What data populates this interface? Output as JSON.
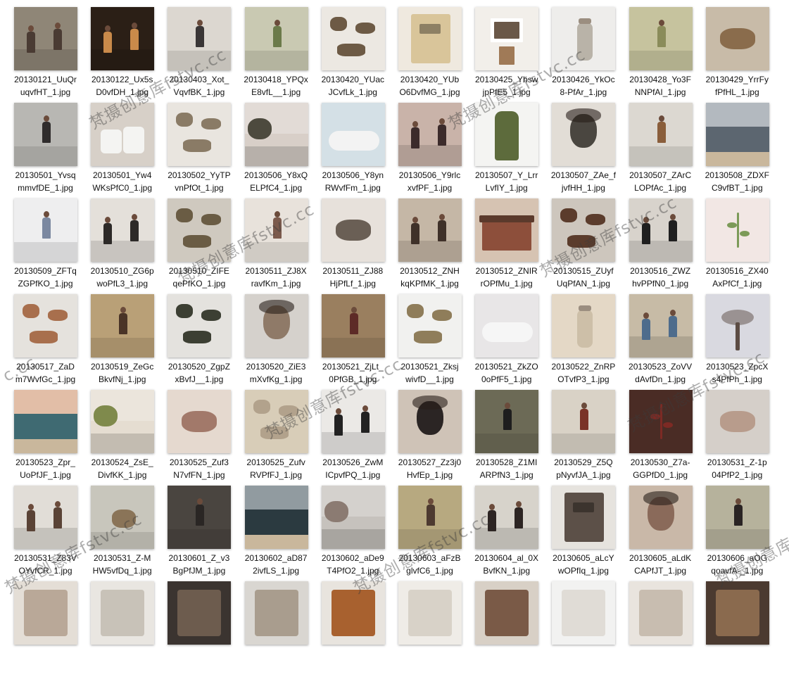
{
  "files": [
    {
      "l1": "20130121_UuQr",
      "l2": "uqvfHT_1.jpg",
      "bg": "#8f8677",
      "fg": "#4a3b33",
      "kind": "people"
    },
    {
      "l1": "20130122_Ux5s",
      "l2": "D0vfDH_1.jpg",
      "bg": "#2b1f16",
      "fg": "#c98a4a",
      "kind": "people"
    },
    {
      "l1": "20130403_Xot_",
      "l2": "VqvfBK_1.jpg",
      "bg": "#dcd7d0",
      "fg": "#3a3636",
      "kind": "person"
    },
    {
      "l1": "20130418_YPQx",
      "l2": "E8vfL__1.jpg",
      "bg": "#c9c9b2",
      "fg": "#6b7a4a",
      "kind": "person"
    },
    {
      "l1": "20130420_YUac",
      "l2": "JCvfLk_1.jpg",
      "bg": "#ece8e2",
      "fg": "#6d5a45",
      "kind": "objects"
    },
    {
      "l1": "20130420_YUb",
      "l2": "O6DvfMG_1.jpg",
      "bg": "#efe9df",
      "fg": "#d9c59a",
      "kind": "book"
    },
    {
      "l1": "20130425_Yhsw",
      "l2": "jpPfE5_1.jpg",
      "bg": "#f2efea",
      "fg": "#6a5848",
      "kind": "frame"
    },
    {
      "l1": "20130426_YkOc",
      "l2": "8-PfAr_1.jpg",
      "bg": "#eeedeb",
      "fg": "#b9b3a8",
      "kind": "jar"
    },
    {
      "l1": "20130428_Yo3F",
      "l2": "NNPfAI_1.jpg",
      "bg": "#c6c39e",
      "fg": "#8a8c5a",
      "kind": "person"
    },
    {
      "l1": "20130429_YrrFy",
      "l2": "fPfHL_1.jpg",
      "bg": "#c8bba8",
      "fg": "#8a6c4c",
      "kind": "hands"
    },
    {
      "l1": "20130501_Yvsq",
      "l2": "mmvfDE_1.jpg",
      "bg": "#b8b7b3",
      "fg": "#2f2c2c",
      "kind": "person"
    },
    {
      "l1": "20130501_Yw4",
      "l2": "WKsPfC0_1.jpg",
      "bg": "#d7d0c8",
      "fg": "#f4f4f2",
      "kind": "shoes"
    },
    {
      "l1": "20130502_YyTP",
      "l2": "vnPfOt_1.jpg",
      "bg": "#e9e5df",
      "fg": "#8a7b66",
      "kind": "objects"
    },
    {
      "l1": "20130506_Y8xQ",
      "l2": "ELPfC4_1.jpg",
      "bg": "#d8cfc8",
      "fg": "#4d4a3e",
      "kind": "road"
    },
    {
      "l1": "20130506_Y8yn",
      "l2": "RWvfFm_1.jpg",
      "bg": "#d4e0e6",
      "fg": "#f3f3f3",
      "kind": "tub"
    },
    {
      "l1": "20130506_Y9rlc",
      "l2": "xvfPF_1.jpg",
      "bg": "#c9b3a9",
      "fg": "#3c2b2b",
      "kind": "people"
    },
    {
      "l1": "20130507_Y_Lrr",
      "l2": "LvfIY_1.jpg",
      "bg": "#f4f4f2",
      "fg": "#5d6b3c",
      "kind": "dress"
    },
    {
      "l1": "20130507_ZAe_f",
      "l2": "jvfHH_1.jpg",
      "bg": "#e2ddd6",
      "fg": "#4a4640",
      "kind": "face"
    },
    {
      "l1": "20130507_ZArC",
      "l2": "LOPfAc_1.jpg",
      "bg": "#dcd8d1",
      "fg": "#8a5e3b",
      "kind": "person"
    },
    {
      "l1": "20130508_ZDXF",
      "l2": "C9vfBT_1.jpg",
      "bg": "#9aa2aa",
      "fg": "#5c6670",
      "kind": "sea"
    },
    {
      "l1": "20130509_ZFTq",
      "l2": "ZGPfKO_1.jpg",
      "bg": "#eeeeef",
      "fg": "#7b88a0",
      "kind": "person"
    },
    {
      "l1": "20130510_ZG6p",
      "l2": "woPfL3_1.jpg",
      "bg": "#e4e0da",
      "fg": "#2d2a28",
      "kind": "people"
    },
    {
      "l1": "20130510_ZIFE",
      "l2": "qePfKO_1.jpg",
      "bg": "#cfc9bf",
      "fg": "#6a5c44",
      "kind": "objects"
    },
    {
      "l1": "20130511_ZJ8X",
      "l2": "ravfKm_1.jpg",
      "bg": "#e8e2db",
      "fg": "#7b5a4c",
      "kind": "person"
    },
    {
      "l1": "20130511_ZJ88",
      "l2": "HjPfLf_1.jpg",
      "bg": "#e7e1db",
      "fg": "#6a5f55",
      "kind": "hands"
    },
    {
      "l1": "20130512_ZNH",
      "l2": "kqKPfMK_1.jpg",
      "bg": "#c5b7a6",
      "fg": "#3f3129",
      "kind": "people"
    },
    {
      "l1": "20130512_ZNIR",
      "l2": "rOPfMu_1.jpg",
      "bg": "#d6c3b2",
      "fg": "#8d4f3b",
      "kind": "house"
    },
    {
      "l1": "20130515_ZUyf",
      "l2": "UqPfAN_1.jpg",
      "bg": "#cdc6bd",
      "fg": "#5b3c2c",
      "kind": "objects"
    },
    {
      "l1": "20130516_ZWZ",
      "l2": "hvPPfN0_1.jpg",
      "bg": "#d8d3cc",
      "fg": "#1f1f1f",
      "kind": "people"
    },
    {
      "l1": "20130516_ZX40",
      "l2": "AxPfCf_1.jpg",
      "bg": "#f2e7e4",
      "fg": "#7c9a58",
      "kind": "flower"
    },
    {
      "l1": "20130517_ZaD",
      "l2": "m7WvfGc_1.jpg",
      "bg": "#e5e2dd",
      "fg": "#a86f4d",
      "kind": "objects"
    },
    {
      "l1": "20130519_ZeGc",
      "l2": "BkvfNj_1.jpg",
      "bg": "#b9a077",
      "fg": "#4a3427",
      "kind": "person"
    },
    {
      "l1": "20130520_ZgpZ",
      "l2": "xBvfJ__1.jpg",
      "bg": "#e4e2de",
      "fg": "#3c3f33",
      "kind": "objects"
    },
    {
      "l1": "20130520_ZiE3",
      "l2": "mXvfKg_1.jpg",
      "bg": "#d5d1cc",
      "fg": "#8f7a68",
      "kind": "face"
    },
    {
      "l1": "20130521_ZjLt_",
      "l2": "0PfGB_1.jpg",
      "bg": "#9a7f5f",
      "fg": "#5d2b27",
      "kind": "person"
    },
    {
      "l1": "20130521_Zksj",
      "l2": "wivfD__1.jpg",
      "bg": "#f1f1ef",
      "fg": "#8f7d5a",
      "kind": "objects"
    },
    {
      "l1": "20130521_ZkZO",
      "l2": "0oPfF5_1.jpg",
      "bg": "#e8e6e7",
      "fg": "#f6f6f6",
      "kind": "tub"
    },
    {
      "l1": "20130522_ZnRP",
      "l2": "OTvfP3_1.jpg",
      "bg": "#e4d8c6",
      "fg": "#cdbfa8",
      "kind": "jar"
    },
    {
      "l1": "20130523_ZoVV",
      "l2": "dAvfDn_1.jpg",
      "bg": "#c7bba6",
      "fg": "#4e6c8c",
      "kind": "people"
    },
    {
      "l1": "20130523_ZpcX",
      "l2": "s4PfPh_1.jpg",
      "bg": "#d9d9e0",
      "fg": "#5c4c44",
      "kind": "tree"
    },
    {
      "l1": "20130523_Zpr_",
      "l2": "UoPfJF_1.jpg",
      "bg": "#d8a88a",
      "fg": "#3f6a72",
      "kind": "sea"
    },
    {
      "l1": "20130524_ZsE_",
      "l2": "DivfKK_1.jpg",
      "bg": "#e5ddd1",
      "fg": "#7f8a4c",
      "kind": "road"
    },
    {
      "l1": "20130525_Zuf3",
      "l2": "N7vfFN_1.jpg",
      "bg": "#e5d9cf",
      "fg": "#a2796a",
      "kind": "hands"
    },
    {
      "l1": "20130525_Zufv",
      "l2": "RVPfFJ_1.jpg",
      "bg": "#d8cdb8",
      "fg": "#b2a28c",
      "kind": "objects"
    },
    {
      "l1": "20130526_ZwM",
      "l2": "ICpvfPQ_1.jpg",
      "bg": "#ebe9e6",
      "fg": "#222222",
      "kind": "people"
    },
    {
      "l1": "20130527_Zz3j0",
      "l2": "HvfEp_1.jpg",
      "bg": "#cfc3b7",
      "fg": "#2b2524",
      "kind": "face"
    },
    {
      "l1": "20130528_Z1MI",
      "l2": "ARPfN3_1.jpg",
      "bg": "#6c6a56",
      "fg": "#1e1e1e",
      "kind": "person"
    },
    {
      "l1": "20130529_Z5Q",
      "l2": "pNyvfJA_1.jpg",
      "bg": "#d9d2c6",
      "fg": "#7a3327",
      "kind": "person"
    },
    {
      "l1": "20130530_Z7a-",
      "l2": "GGPfD0_1.jpg",
      "bg": "#4a2c25",
      "fg": "#7d2a24",
      "kind": "flower"
    },
    {
      "l1": "20130531_Z-1p",
      "l2": "04PfP2_1.jpg",
      "bg": "#d5cfc9",
      "fg": "#b89c8c",
      "kind": "hands"
    },
    {
      "l1": "20130531_Z83V",
      "l2": "OYvfCR_1.jpg",
      "bg": "#e1ddd7",
      "fg": "#5a4336",
      "kind": "people"
    },
    {
      "l1": "20130531_Z-M",
      "l2": "HW5vfDq_1.jpg",
      "bg": "#c8c6bc",
      "fg": "#8a7458",
      "kind": "animal"
    },
    {
      "l1": "20130601_Z_v3",
      "l2": "BgPfJM_1.jpg",
      "bg": "#4a4540",
      "fg": "#2a2624",
      "kind": "person"
    },
    {
      "l1": "20130602_aD87",
      "l2": "2ivfLS_1.jpg",
      "bg": "#6d7a80",
      "fg": "#2b3a40",
      "kind": "sea"
    },
    {
      "l1": "20130602_aDe9",
      "l2": "T4PfO2_1.jpg",
      "bg": "#c6c2bd",
      "fg": "#8b7b72",
      "kind": "road"
    },
    {
      "l1": "20130603_aFzB",
      "l2": "glvfC6_1.jpg",
      "bg": "#b7a980",
      "fg": "#4d3a30",
      "kind": "person"
    },
    {
      "l1": "20130604_al_0X",
      "l2": "BvfKN_1.jpg",
      "bg": "#d7d3cb",
      "fg": "#2d2523",
      "kind": "people"
    },
    {
      "l1": "20130605_aLcY",
      "l2": "wOPfIq_1.jpg",
      "bg": "#e6e3de",
      "fg": "#5c5048",
      "kind": "book"
    },
    {
      "l1": "20130605_aLdK",
      "l2": "CAPfJT_1.jpg",
      "bg": "#c9b8a8",
      "fg": "#8a6a5a",
      "kind": "face"
    },
    {
      "l1": "20130606_aOG",
      "l2": "qoavfA-_1.jpg",
      "bg": "#b6b29c",
      "fg": "#2a2424",
      "kind": "person"
    },
    {
      "l1": "",
      "l2": "",
      "bg": "#e4ded6",
      "fg": "#b9a898",
      "kind": "plain"
    },
    {
      "l1": "",
      "l2": "",
      "bg": "#e9e6e1",
      "fg": "#c8c2b8",
      "kind": "plain"
    },
    {
      "l1": "",
      "l2": "",
      "bg": "#3b3430",
      "fg": "#6d5c4e",
      "kind": "plain"
    },
    {
      "l1": "",
      "l2": "",
      "bg": "#d9d6d1",
      "fg": "#a99d8e",
      "kind": "plain"
    },
    {
      "l1": "",
      "l2": "",
      "bg": "#e8e4de",
      "fg": "#a8612f",
      "kind": "plain"
    },
    {
      "l1": "",
      "l2": "",
      "bg": "#efece7",
      "fg": "#d8d2c8",
      "kind": "plain"
    },
    {
      "l1": "",
      "l2": "",
      "bg": "#d8d0c6",
      "fg": "#7a5a47",
      "kind": "plain"
    },
    {
      "l1": "",
      "l2": "",
      "bg": "#f2f2f1",
      "fg": "#e0dcd6",
      "kind": "plain"
    },
    {
      "l1": "",
      "l2": "",
      "bg": "#e9e4de",
      "fg": "#c8bdb0",
      "kind": "plain"
    },
    {
      "l1": "",
      "l2": "",
      "bg": "#4b3a30",
      "fg": "#8a6a4e",
      "kind": "plain"
    }
  ],
  "watermark": {
    "text": "梵摄创意库fstvc.cc",
    "text_tail": "c.cc",
    "text_head": "梵摄创意库f",
    "text_head2": "梵摄创意库f"
  }
}
